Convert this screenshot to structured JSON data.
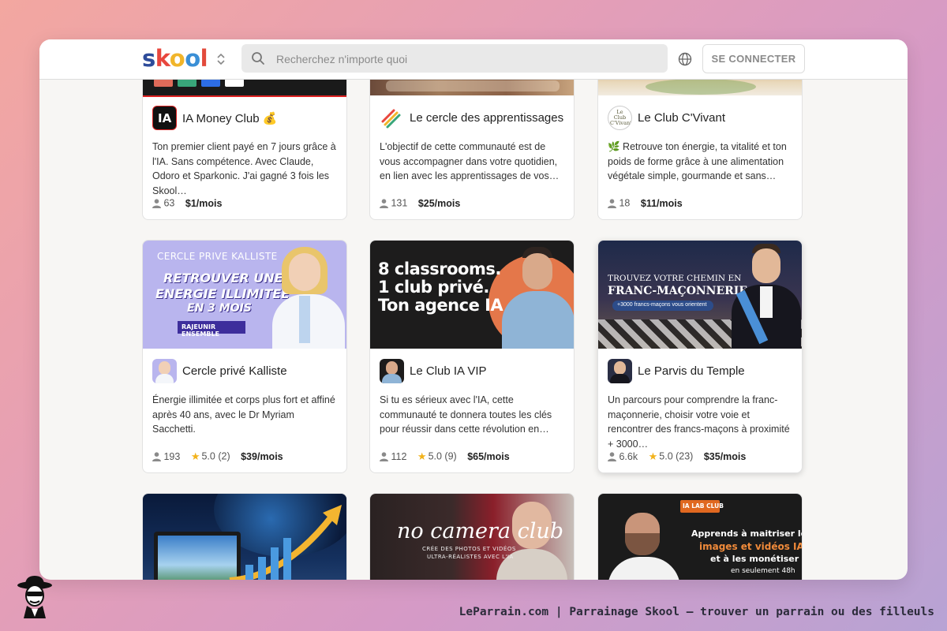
{
  "header": {
    "logo": "skool",
    "search_placeholder": "Recherchez n'importe quoi",
    "login_label": "SE CONNECTER"
  },
  "cards": [
    {
      "name": "IA Money Club 💰",
      "description": "Ton premier client payé en 7 jours grâce à l'IA. Sans compétence. Avec Claude, Odoro et Sparkonic. J'ai gagné 3 fois les Skool…",
      "members": "63",
      "price": "$1/mois",
      "avatar_text": "IA"
    },
    {
      "name": "Le cercle des apprentissages",
      "description": "L'objectif de cette communauté est de vous accompagner dans votre quotidien, en lien avec les apprentissages de vos…",
      "members": "131",
      "price": "$25/mois"
    },
    {
      "name": "Le Club C'Vivant",
      "description": "🌿 Retrouve ton énergie, ta vitalité et ton poids de forme grâce à une alimentation végétale simple, gourmande et sans…",
      "members": "18",
      "price": "$11/mois",
      "avatar_text": "Le Club C'Vivant"
    },
    {
      "name": "Cercle privé Kalliste",
      "description": "Énergie illimitée et corps plus fort et affiné après 40 ans, avec le Dr Myriam Sacchetti.",
      "members": "193",
      "rating": "5.0 (2)",
      "price": "$39/mois",
      "banner": {
        "top": "CERCLE PRIVE KALLISTE",
        "line1": "RETROUVER UNE",
        "line2": "ENERGIE ILLIMITEE",
        "line3": "EN 3 MOIS",
        "tag": "RAJEUNIR ENSEMBLE"
      }
    },
    {
      "name": "Le Club IA VIP",
      "description": "Si tu es sérieux avec l'IA, cette communauté te donnera toutes les clés pour réussir dans cette révolution en…",
      "members": "112",
      "rating": "5.0 (9)",
      "price": "$65/mois",
      "banner": {
        "line1": "8 classrooms.",
        "line2": "1 club privé.",
        "line3": "Ton agence IA"
      }
    },
    {
      "name": "Le Parvis du Temple",
      "description": "Un parcours pour comprendre la franc-maçonnerie, choisir votre voie et rencontrer des francs-maçons à proximité + 3000…",
      "members": "6.6k",
      "rating": "5.0 (23)",
      "price": "$35/mois",
      "banner": {
        "line1": "TROUVEZ VOTRE CHEMIN EN",
        "line2": "FRANC-MAÇONNERIE",
        "line3": "+3000 francs-maçons vous orientent"
      }
    },
    {
      "banner": {}
    },
    {
      "banner": {
        "line1": "no camera club",
        "line2": "CRÉE DES PHOTOS ET VIDÉOS",
        "line3": "ULTRA-RÉALISTES AVEC L'IA"
      }
    },
    {
      "banner": {
        "badge": "IA LAB CLUB",
        "line1": "Apprends à maitriser les",
        "line2": "images et vidéos IA",
        "line3": "et à les monétiser",
        "line4": "en seulement 48h"
      }
    }
  ],
  "footer": {
    "caption": "LeParrain.com | Parrainage Skool — trouver un parrain ou des filleuls"
  },
  "colors": {
    "accent_price": "#222222",
    "star": "#f2b21a",
    "background_gradient": [
      "#f3a7a0",
      "#b7a3d4"
    ]
  }
}
